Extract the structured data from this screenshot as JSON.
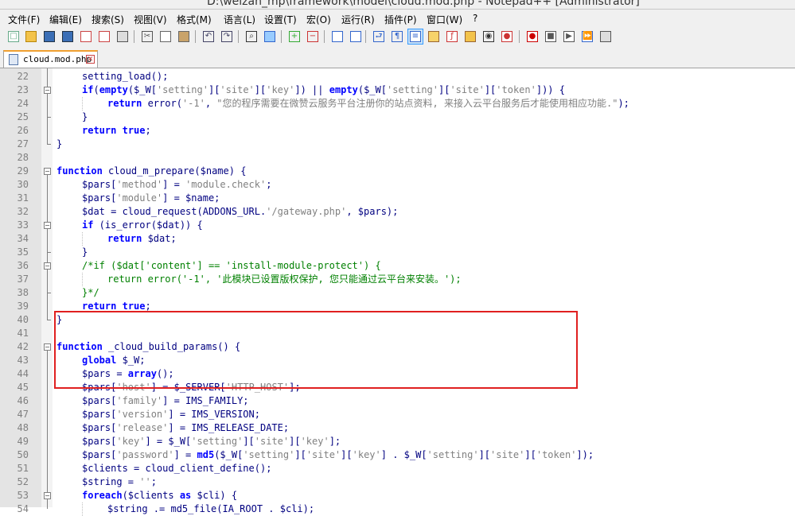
{
  "window": {
    "title": "D:\\weizan_mp\\framework\\model\\cloud.mod.php - Notepad++ [Administrator]"
  },
  "menu": [
    "文件(F)",
    "编辑(E)",
    "搜索(S)",
    "视图(V)",
    "格式(M)",
    "语言(L)",
    "设置(T)",
    "宏(O)",
    "运行(R)",
    "插件(P)",
    "窗口(W)",
    "?"
  ],
  "toolbar": {
    "icons": [
      "new-file-icon",
      "open-file-icon",
      "save-icon",
      "save-all-icon",
      "close-icon",
      "close-all-icon",
      "print-icon",
      "cut-icon",
      "copy-icon",
      "paste-icon",
      "undo-icon",
      "redo-icon",
      "find-icon",
      "replace-icon",
      "zoom-in-icon",
      "zoom-out-icon",
      "sync-vertical-icon",
      "sync-horizontal-icon",
      "word-wrap-icon",
      "show-all-characters-icon",
      "indent-guide-icon",
      "user-language-icon",
      "function-list-icon",
      "folder-workspace-icon",
      "document-map-icon",
      "monitor-icon",
      "record-macro-icon",
      "stop-macro-icon",
      "play-macro-icon",
      "run-macro-multiple-icon",
      "save-macro-icon"
    ],
    "active": "indent-guide-icon"
  },
  "tab": {
    "label": "cloud.mod.php"
  },
  "colors": {
    "keyword": "#0000ff",
    "string": "#808080",
    "comment": "#008000",
    "default": "#000080",
    "highlight": "#e02020"
  },
  "lines": [
    {
      "n": "22",
      "indent": 1,
      "tokens": [
        [
          "setting_load",
          "d"
        ],
        [
          "();",
          "d"
        ]
      ]
    },
    {
      "n": "23",
      "indent": 1,
      "tokens": [
        [
          "if",
          "k"
        ],
        [
          "(",
          "d"
        ],
        [
          "empty",
          "k"
        ],
        [
          "($_W[",
          "d"
        ],
        [
          "'setting'",
          "s"
        ],
        [
          "][",
          "d"
        ],
        [
          "'site'",
          "s"
        ],
        [
          "][",
          "d"
        ],
        [
          "'key'",
          "s"
        ],
        [
          "]) || ",
          "d"
        ],
        [
          "empty",
          "k"
        ],
        [
          "($_W[",
          "d"
        ],
        [
          "'setting'",
          "s"
        ],
        [
          "][",
          "d"
        ],
        [
          "'site'",
          "s"
        ],
        [
          "][",
          "d"
        ],
        [
          "'token'",
          "s"
        ],
        [
          "])) {",
          "d"
        ]
      ]
    },
    {
      "n": "24",
      "indent": 2,
      "tokens": [
        [
          "return",
          "k"
        ],
        [
          " error(",
          "d"
        ],
        [
          "'-1'",
          "s"
        ],
        [
          ", ",
          "d"
        ],
        [
          "\"您的程序需要在微赞云服务平台注册你的站点资料, 来接入云平台服务后才能使用相应功能.\"",
          "s"
        ],
        [
          ");",
          "d"
        ]
      ]
    },
    {
      "n": "25",
      "indent": 1,
      "tokens": [
        [
          "}",
          "d"
        ]
      ]
    },
    {
      "n": "26",
      "indent": 1,
      "tokens": [
        [
          "return",
          "k"
        ],
        [
          " ",
          "d"
        ],
        [
          "true",
          "k"
        ],
        [
          ";",
          "d"
        ]
      ]
    },
    {
      "n": "27",
      "indent": 0,
      "tokens": [
        [
          "}",
          "d"
        ]
      ]
    },
    {
      "n": "28",
      "indent": 0,
      "tokens": []
    },
    {
      "n": "29",
      "indent": 0,
      "tokens": [
        [
          "function",
          "k"
        ],
        [
          " cloud_m_prepare($name) {",
          "d"
        ]
      ]
    },
    {
      "n": "30",
      "indent": 1,
      "tokens": [
        [
          "$pars[",
          "d"
        ],
        [
          "'method'",
          "s"
        ],
        [
          "] = ",
          "d"
        ],
        [
          "'module.check'",
          "s"
        ],
        [
          ";",
          "d"
        ]
      ]
    },
    {
      "n": "31",
      "indent": 1,
      "tokens": [
        [
          "$pars[",
          "d"
        ],
        [
          "'module'",
          "s"
        ],
        [
          "] = $name;",
          "d"
        ]
      ]
    },
    {
      "n": "32",
      "indent": 1,
      "tokens": [
        [
          "$dat = cloud_request(ADDONS_URL.",
          "d"
        ],
        [
          "'/gateway.php'",
          "s"
        ],
        [
          ", $pars);",
          "d"
        ]
      ]
    },
    {
      "n": "33",
      "indent": 1,
      "tokens": [
        [
          "if",
          "k"
        ],
        [
          " (is_error($dat)) {",
          "d"
        ]
      ]
    },
    {
      "n": "34",
      "indent": 2,
      "tokens": [
        [
          "return",
          "k"
        ],
        [
          " $dat;",
          "d"
        ]
      ]
    },
    {
      "n": "35",
      "indent": 1,
      "tokens": [
        [
          "}",
          "d"
        ]
      ]
    },
    {
      "n": "36",
      "indent": 1,
      "tokens": [
        [
          "/*if ($dat['content'] == 'install-module-protect') {",
          "c"
        ]
      ]
    },
    {
      "n": "37",
      "indent": 2,
      "tokens": [
        [
          "return error('-1', '此模块已设置版权保护, 您只能通过云平台来安装。');",
          "c"
        ]
      ]
    },
    {
      "n": "38",
      "indent": 1,
      "tokens": [
        [
          "}*/",
          "c"
        ]
      ]
    },
    {
      "n": "39",
      "indent": 1,
      "tokens": [
        [
          "return",
          "k"
        ],
        [
          " ",
          "d"
        ],
        [
          "true",
          "k"
        ],
        [
          ";",
          "d"
        ]
      ]
    },
    {
      "n": "40",
      "indent": 0,
      "tokens": [
        [
          "}",
          "d"
        ]
      ]
    },
    {
      "n": "41",
      "indent": 0,
      "tokens": []
    },
    {
      "n": "42",
      "indent": 0,
      "tokens": [
        [
          "function",
          "k"
        ],
        [
          " _cloud_build_params() {",
          "d"
        ]
      ]
    },
    {
      "n": "43",
      "indent": 1,
      "tokens": [
        [
          "global",
          "k"
        ],
        [
          " $_W;",
          "d"
        ]
      ]
    },
    {
      "n": "44",
      "indent": 1,
      "tokens": [
        [
          "$pars = ",
          "d"
        ],
        [
          "array",
          "k"
        ],
        [
          "();",
          "d"
        ]
      ]
    },
    {
      "n": "45",
      "indent": 1,
      "tokens": [
        [
          "$pars[",
          "d"
        ],
        [
          "'host'",
          "s"
        ],
        [
          "] = $_SERVER[",
          "d"
        ],
        [
          "'HTTP_HOST'",
          "s"
        ],
        [
          "];",
          "d"
        ]
      ]
    },
    {
      "n": "46",
      "indent": 1,
      "tokens": [
        [
          "$pars[",
          "d"
        ],
        [
          "'family'",
          "s"
        ],
        [
          "] = IMS_FAMILY;",
          "d"
        ]
      ]
    },
    {
      "n": "47",
      "indent": 1,
      "tokens": [
        [
          "$pars[",
          "d"
        ],
        [
          "'version'",
          "s"
        ],
        [
          "] = IMS_VERSION;",
          "d"
        ]
      ]
    },
    {
      "n": "48",
      "indent": 1,
      "tokens": [
        [
          "$pars[",
          "d"
        ],
        [
          "'release'",
          "s"
        ],
        [
          "] = IMS_RELEASE_DATE;",
          "d"
        ]
      ]
    },
    {
      "n": "49",
      "indent": 1,
      "tokens": [
        [
          "$pars[",
          "d"
        ],
        [
          "'key'",
          "s"
        ],
        [
          "] = $_W[",
          "d"
        ],
        [
          "'setting'",
          "s"
        ],
        [
          "][",
          "d"
        ],
        [
          "'site'",
          "s"
        ],
        [
          "][",
          "d"
        ],
        [
          "'key'",
          "s"
        ],
        [
          "];",
          "d"
        ]
      ]
    },
    {
      "n": "50",
      "indent": 1,
      "tokens": [
        [
          "$pars[",
          "d"
        ],
        [
          "'password'",
          "s"
        ],
        [
          "] = ",
          "d"
        ],
        [
          "md5",
          "k"
        ],
        [
          "($_W[",
          "d"
        ],
        [
          "'setting'",
          "s"
        ],
        [
          "][",
          "d"
        ],
        [
          "'site'",
          "s"
        ],
        [
          "][",
          "d"
        ],
        [
          "'key'",
          "s"
        ],
        [
          "] . $_W[",
          "d"
        ],
        [
          "'setting'",
          "s"
        ],
        [
          "][",
          "d"
        ],
        [
          "'site'",
          "s"
        ],
        [
          "][",
          "d"
        ],
        [
          "'token'",
          "s"
        ],
        [
          "]);",
          "d"
        ]
      ]
    },
    {
      "n": "51",
      "indent": 1,
      "tokens": [
        [
          "$clients = cloud_client_define();",
          "d"
        ]
      ]
    },
    {
      "n": "52",
      "indent": 1,
      "tokens": [
        [
          "$string = ",
          "d"
        ],
        [
          "''",
          "s"
        ],
        [
          ";",
          "d"
        ]
      ]
    },
    {
      "n": "53",
      "indent": 1,
      "tokens": [
        [
          "foreach",
          "k"
        ],
        [
          "($clients ",
          "d"
        ],
        [
          "as",
          "k"
        ],
        [
          " $cli) {",
          "d"
        ]
      ]
    },
    {
      "n": "54",
      "indent": 2,
      "tokens": [
        [
          "$string .= md5_file(IA_ROOT . $cli);",
          "d"
        ]
      ]
    }
  ]
}
